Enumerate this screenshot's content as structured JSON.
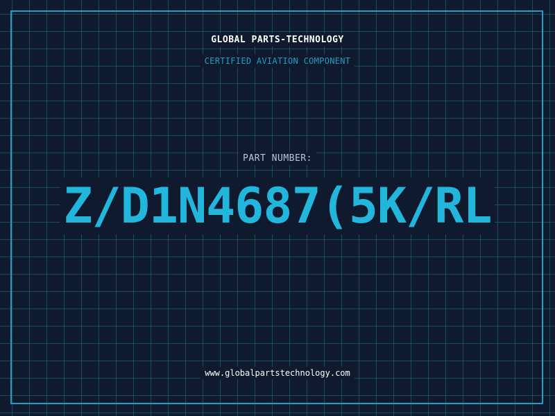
{
  "header": {
    "company": "GLOBAL PARTS-TECHNOLOGY",
    "tagline": "CERTIFIED AVIATION COMPONENT"
  },
  "part": {
    "label": "PART NUMBER:",
    "number": "Z/D1N4687(5K/RL"
  },
  "footer": {
    "website": "www.globalpartstechnology.com"
  },
  "colors": {
    "background": "#0f1a2e",
    "accent": "#1e9fc4",
    "part_number": "#22b6dd",
    "grid": "#266e8c"
  }
}
